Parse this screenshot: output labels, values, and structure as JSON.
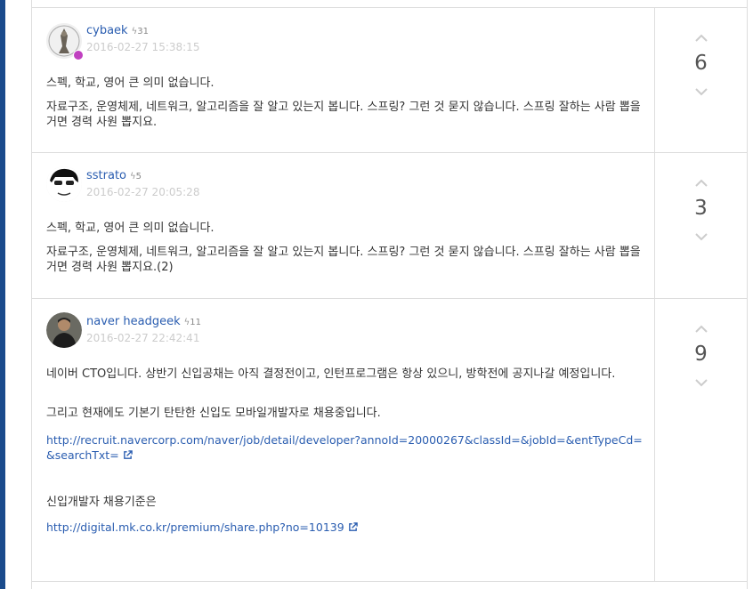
{
  "answers": [
    {
      "author": "cybaek",
      "reputation": "31",
      "date": "2016-02-27 15:38:15",
      "votes": "6",
      "paragraphs": [
        "스펙, 학교, 영어 큰 의미 없습니다.",
        "자료구조, 운영체제, 네트워크, 알고리즘을 잘 알고 있는지 봅니다. 스프링? 그런 것 묻지 않습니다. 스프링 잘하는 사람 뽑을거면 경력 사원 뽑지요."
      ]
    },
    {
      "author": "sstrato",
      "reputation": "5",
      "date": "2016-02-27 20:05:28",
      "votes": "3",
      "paragraphs": [
        "스펙, 학교, 영어 큰 의미 없습니다.",
        "자료구조, 운영체제, 네트워크, 알고리즘을 잘 알고 있는지 봅니다. 스프링? 그런 것 묻지 않습니다. 스프링 잘하는 사람 뽑을거면 경력 사원 뽑지요.(2)"
      ]
    },
    {
      "author": "naver headgeek",
      "reputation": "11",
      "date": "2016-02-27 22:42:41",
      "votes": "9",
      "paragraphs": [
        "네이버 CTO입니다. 상반기 신입공채는 아직 결정전이고, 인턴프로그램은 항상 있으니, 방학전에 공지나갈 예정입니다.",
        "그리고 현재에도 기본기 탄탄한 신입도 모바일개발자로 채용중입니다.",
        "신입개발자 채용기준은"
      ],
      "links": [
        "http://recruit.navercorp.com/naver/job/detail/developer?annoId=20000267&classId=&jobId=&entTypeCd=&searchTxt=",
        "http://digital.mk.co.kr/premium/share.php?no=10139"
      ]
    }
  ],
  "icons": {
    "upvote": "chevron-up-icon",
    "downvote": "chevron-down-icon",
    "reputation": "lightning-icon",
    "external": "external-link-icon"
  },
  "colors": {
    "link": "#2a5db0",
    "date": "#cccccc",
    "left_bar": "#1a4b8c",
    "badge": "#c040c0"
  }
}
